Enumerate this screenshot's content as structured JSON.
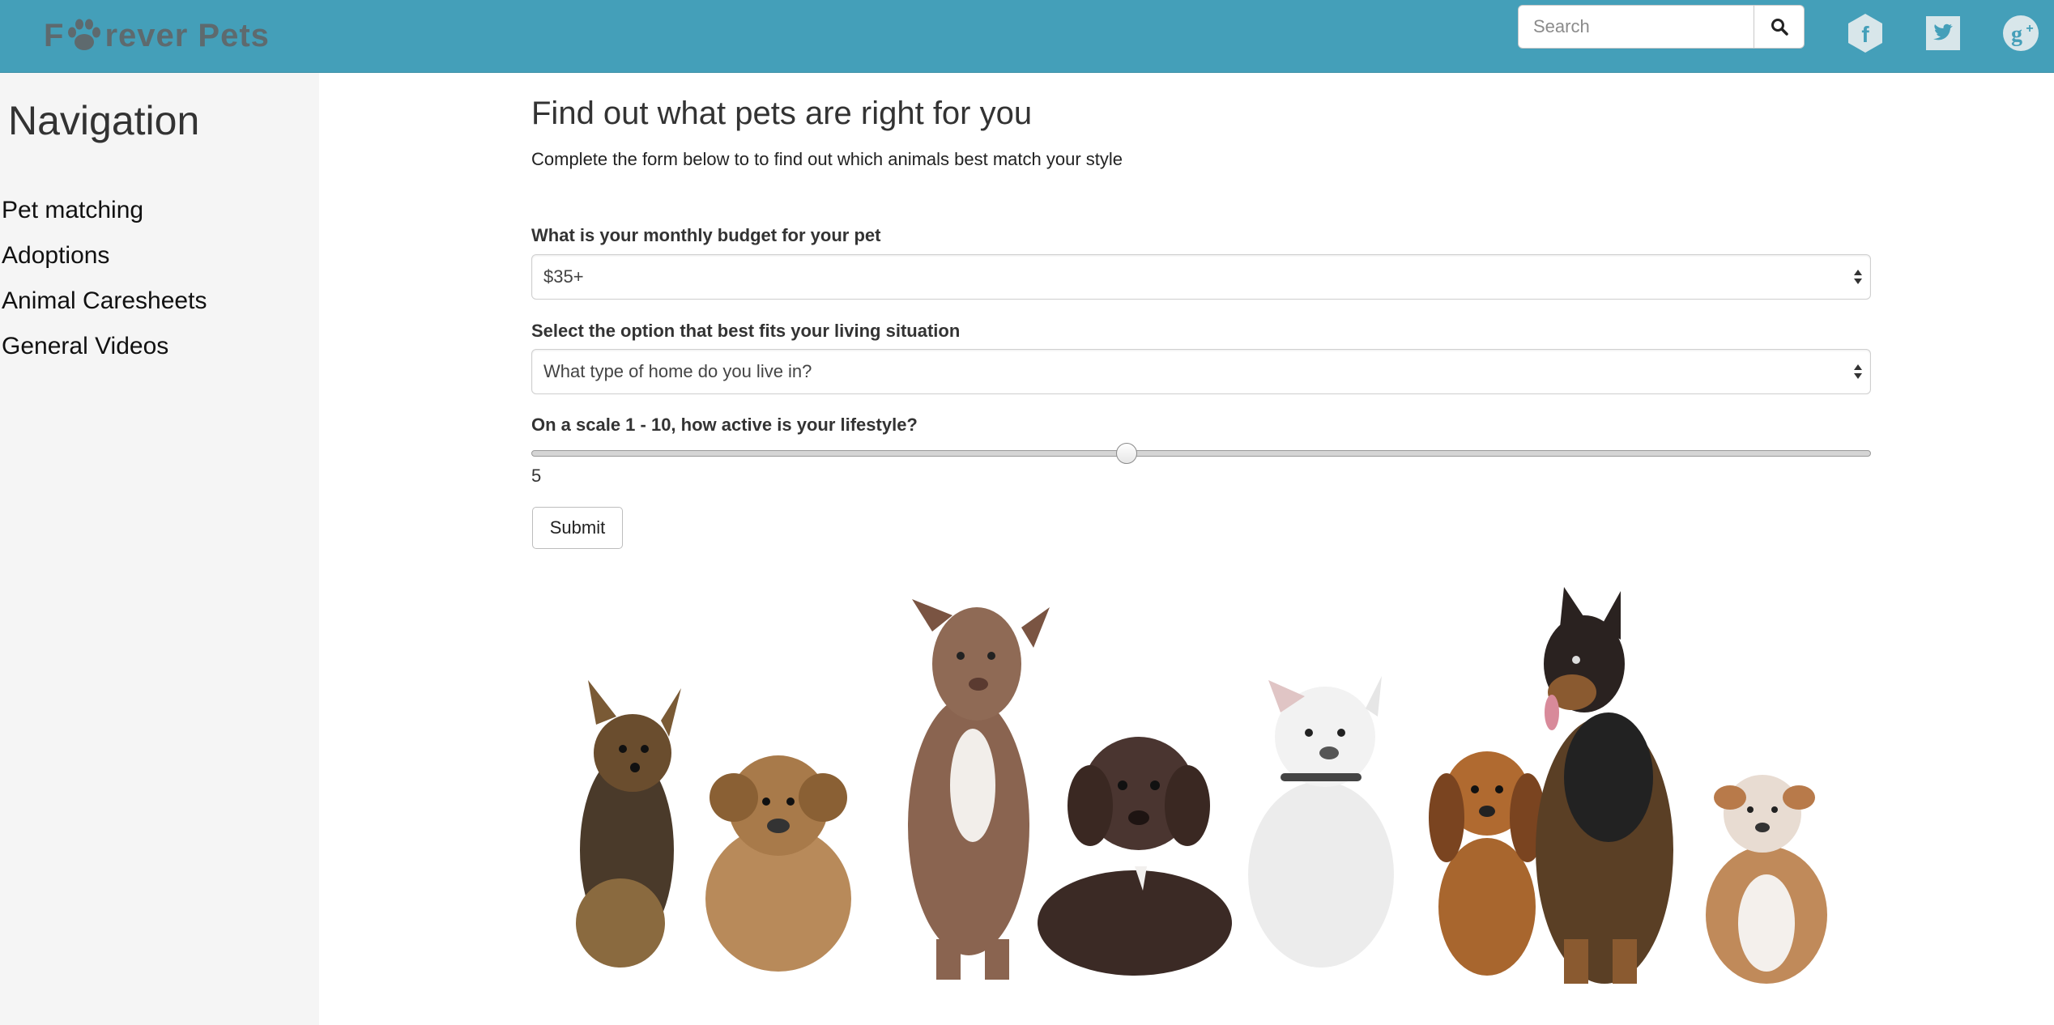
{
  "header": {
    "brand": {
      "prefix": "F",
      "suffix": "rever Pets"
    },
    "search": {
      "placeholder": "Search"
    },
    "social": [
      "facebook-icon",
      "twitter-icon",
      "google-plus-icon"
    ],
    "colors": {
      "bar": "#449fb9",
      "logo": "#5e6a6e",
      "social": "#d8e6ea"
    }
  },
  "sidebar": {
    "title": "Navigation",
    "items": [
      {
        "label": "Pet matching"
      },
      {
        "label": "Adoptions"
      },
      {
        "label": "Animal Caresheets"
      },
      {
        "label": "General Videos"
      }
    ]
  },
  "main": {
    "title": "Find out what pets are right for you",
    "subtitle": "Complete the form below to to find out which animals best match your style",
    "budget": {
      "label": "What is your monthly budget for your pet",
      "selected": "$35+"
    },
    "living": {
      "label": "Select the option that best fits your living situation",
      "selected": "What type of home do you live in?"
    },
    "activity": {
      "label": "On a scale 1 - 10, how active is your lifestyle?",
      "value": "5",
      "min": 1,
      "max": 10
    },
    "submit_label": "Submit",
    "image_alt": "puppies-photo"
  }
}
